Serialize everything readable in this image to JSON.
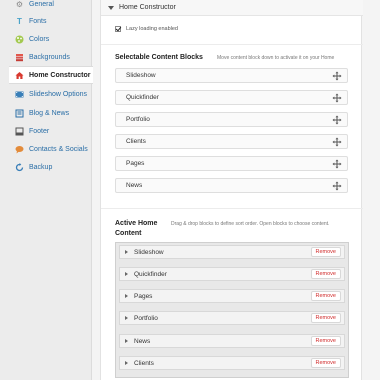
{
  "sidebar": {
    "items": [
      {
        "label": "General",
        "icon": "gear-icon",
        "color": "#8a8a8a"
      },
      {
        "label": "Fonts",
        "icon": "fonts-icon",
        "color": "#4aa3c9"
      },
      {
        "label": "Colors",
        "icon": "palette-icon",
        "color": "#8bb640"
      },
      {
        "label": "Backgrounds",
        "icon": "layers-icon",
        "color": "#d9534f"
      },
      {
        "label": "Home Constructor",
        "icon": "home-constructor-icon",
        "color": "#c9302c",
        "active": true
      },
      {
        "label": "Slideshow Options",
        "icon": "film-icon",
        "color": "#3a7fb8"
      },
      {
        "label": "Blog & News",
        "icon": "blog-icon",
        "color": "#2a6ea6"
      },
      {
        "label": "Footer",
        "icon": "footer-icon",
        "color": "#555"
      },
      {
        "label": "Contacts & Socials",
        "icon": "chat-icon",
        "color": "#e38b3a"
      },
      {
        "label": "Backup",
        "icon": "backup-icon",
        "color": "#3a7fb8"
      }
    ]
  },
  "header": {
    "title": "Home Constructor"
  },
  "lazy_loading": {
    "label": "Lazy loading enabled",
    "checked": true
  },
  "selectable": {
    "title": "Selectable Content Blocks",
    "description": "Move content block down to activate it on your Home",
    "items": [
      "Slideshow",
      "Quickfinder",
      "Portfolio",
      "Clients",
      "Pages",
      "News"
    ]
  },
  "active": {
    "title_line1": "Active Home",
    "title_line2": "Content",
    "description": "Drag & drop blocks to define sort order. Open blocks to choose content.",
    "remove_label": "Remove",
    "items": [
      "Slideshow",
      "Quickfinder",
      "Pages",
      "Portfolio",
      "News",
      "Clients"
    ]
  }
}
